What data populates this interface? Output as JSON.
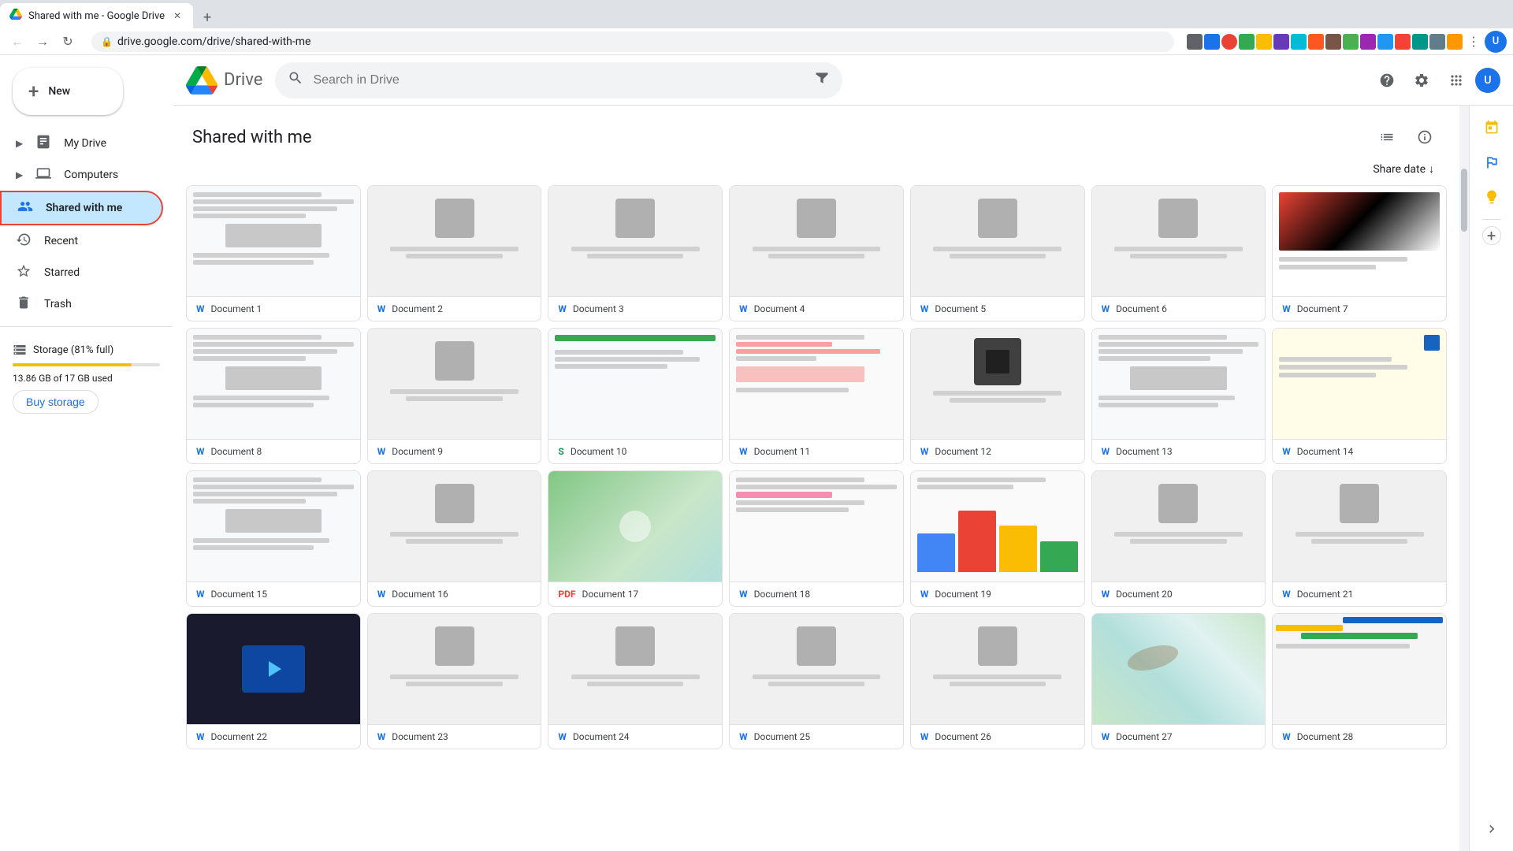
{
  "browser": {
    "tab_title": "Shared with me - Google Drive",
    "tab_favicon": "📁",
    "url": "drive.google.com/drive/shared-with-me",
    "new_tab_label": "+",
    "nav_back": "←",
    "nav_forward": "→",
    "nav_refresh": "↻",
    "nav_home": "⌂"
  },
  "drive_header": {
    "logo_text": "Drive",
    "search_placeholder": "Search in Drive",
    "help_label": "?",
    "settings_label": "⚙",
    "apps_label": "⋮"
  },
  "sidebar": {
    "new_label": "New",
    "nav_items": [
      {
        "id": "my-drive",
        "label": "My Drive",
        "icon": "🗂",
        "expandable": true
      },
      {
        "id": "computers",
        "label": "Computers",
        "icon": "💻",
        "expandable": true
      },
      {
        "id": "shared-with-me",
        "label": "Shared with me",
        "icon": "👤",
        "active": true
      },
      {
        "id": "recent",
        "label": "Recent",
        "icon": "🕐"
      },
      {
        "id": "starred",
        "label": "Starred",
        "icon": "☆"
      },
      {
        "id": "trash",
        "label": "Trash",
        "icon": "🗑"
      }
    ],
    "storage_label": "Storage (81% full)",
    "storage_used": "13.86 GB of 17 GB used",
    "storage_percent": 81,
    "buy_storage_label": "Buy storage"
  },
  "main": {
    "page_title": "Shared with me",
    "sort_label": "Share date",
    "sort_icon": "↓",
    "view_list_label": "List view",
    "view_info_label": "View details"
  },
  "file_grid": {
    "files": [
      {
        "id": 1,
        "name": "Document 1",
        "icon_type": "doc",
        "preview_type": "doc-text"
      },
      {
        "id": 2,
        "name": "Document 2",
        "icon_type": "doc",
        "preview_type": "doc-img"
      },
      {
        "id": 3,
        "name": "Document 3",
        "icon_type": "doc",
        "preview_type": "doc-img"
      },
      {
        "id": 4,
        "name": "Document 4",
        "icon_type": "doc",
        "preview_type": "doc-img"
      },
      {
        "id": 5,
        "name": "Document 5",
        "icon_type": "doc",
        "preview_type": "doc-img"
      },
      {
        "id": 6,
        "name": "Document 6",
        "icon_type": "doc",
        "preview_type": "doc-img"
      },
      {
        "id": 7,
        "name": "Document 7",
        "icon_type": "doc",
        "preview_type": "doc-colorful"
      },
      {
        "id": 8,
        "name": "Document 8",
        "icon_type": "doc",
        "preview_type": "doc-text"
      },
      {
        "id": 9,
        "name": "Document 9",
        "icon_type": "doc",
        "preview_type": "doc-img"
      },
      {
        "id": 10,
        "name": "Document 10",
        "icon_type": "sheet",
        "preview_type": "doc-green-bar"
      },
      {
        "id": 11,
        "name": "Document 11",
        "icon_type": "doc",
        "preview_type": "doc-pink"
      },
      {
        "id": 12,
        "name": "Document 12",
        "icon_type": "doc",
        "preview_type": "doc-dark"
      },
      {
        "id": 13,
        "name": "Document 13",
        "icon_type": "doc",
        "preview_type": "doc-text"
      },
      {
        "id": 14,
        "name": "Document 14",
        "icon_type": "doc",
        "preview_type": "doc-yellow"
      },
      {
        "id": 15,
        "name": "Document 15",
        "icon_type": "doc",
        "preview_type": "doc-text"
      },
      {
        "id": 16,
        "name": "Document 16",
        "icon_type": "doc",
        "preview_type": "doc-img"
      },
      {
        "id": 17,
        "name": "Document 17",
        "icon_type": "pdf",
        "preview_type": "doc-map"
      },
      {
        "id": 18,
        "name": "Document 18",
        "icon_type": "doc",
        "preview_type": "doc-text-pink"
      },
      {
        "id": 19,
        "name": "Document 19",
        "icon_type": "doc",
        "preview_type": "doc-chart"
      },
      {
        "id": 20,
        "name": "Document 20",
        "icon_type": "doc",
        "preview_type": "doc-img"
      },
      {
        "id": 21,
        "name": "Document 21",
        "icon_type": "doc",
        "preview_type": "doc-img"
      },
      {
        "id": 22,
        "name": "Document 22",
        "icon_type": "doc",
        "preview_type": "doc-dark-video"
      },
      {
        "id": 23,
        "name": "Document 23",
        "icon_type": "doc",
        "preview_type": "doc-img"
      },
      {
        "id": 24,
        "name": "Document 24",
        "icon_type": "doc",
        "preview_type": "doc-img"
      },
      {
        "id": 25,
        "name": "Document 25",
        "icon_type": "doc",
        "preview_type": "doc-img"
      },
      {
        "id": 26,
        "name": "Document 26",
        "icon_type": "doc",
        "preview_type": "doc-img"
      },
      {
        "id": 27,
        "name": "Document 27",
        "icon_type": "doc",
        "preview_type": "doc-map2"
      },
      {
        "id": 28,
        "name": "Document 28",
        "icon_type": "doc",
        "preview_type": "doc-colorful2"
      }
    ]
  },
  "side_panel": {
    "calendar_icon": "📅",
    "tasks_icon": "✓",
    "keep_icon": "💡",
    "contacts_icon": "👤",
    "add_icon": "+"
  }
}
